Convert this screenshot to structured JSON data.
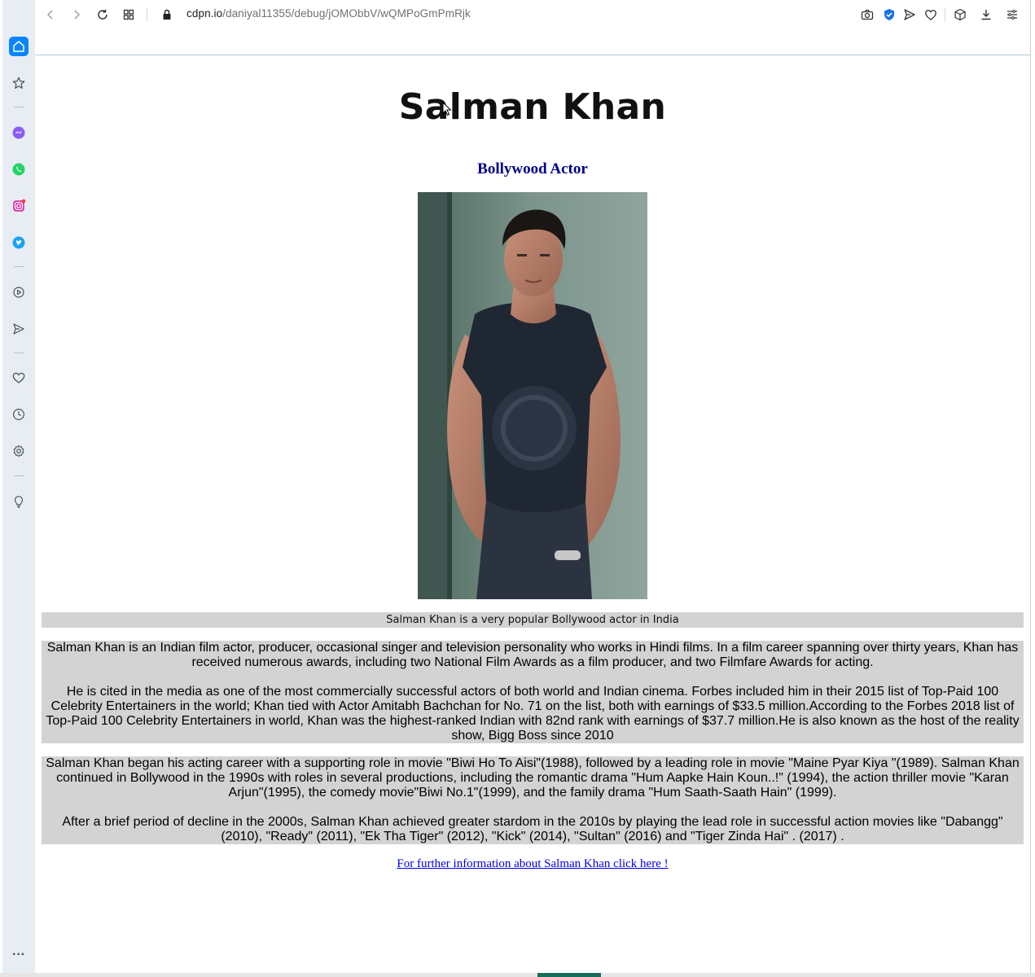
{
  "browser": {
    "url_domain": "cdpn.io",
    "url_path": "/daniyal11355/debug/jOMObbV/wQMPoGmPmRjk",
    "toolbar_icons": [
      "back-icon",
      "forward-icon",
      "reload-icon",
      "tabs-grid-icon",
      "lock-icon",
      "camera-icon",
      "shield-icon",
      "send-icon",
      "heart-icon",
      "box-icon",
      "download-icon",
      "menu-icon"
    ]
  },
  "sidebar": {
    "items": [
      "home-icon",
      "star-icon",
      "messenger-icon",
      "whatsapp-icon",
      "instagram-icon",
      "twitter-icon",
      "player-icon",
      "send-icon",
      "heart-icon",
      "history-icon",
      "settings-icon",
      "lightbulb-icon",
      "more-icon"
    ],
    "more_label": "···"
  },
  "page": {
    "title": "Salman Khan",
    "subtitle": "Bollywood Actor",
    "caption": "Salman Khan is a very popular Bollywood actor in India",
    "block1": {
      "p1": "Salman Khan is an Indian film actor, producer, occasional singer and television personality who works in Hindi films. In a film career spanning over thirty years, Khan has received numerous awards, including two National Film Awards as a film producer, and two Filmfare Awards for acting.",
      "p2": "He is cited in the media as one of the most commercially successful actors of both world and Indian cinema. Forbes included him in their 2015 list of Top-Paid 100 Celebrity Entertainers in the world; Khan tied with Actor Amitabh Bachchan for No. 71 on the list, both with earnings of $33.5 million.According to the Forbes 2018 list of Top-Paid 100 Celebrity Entertainers in world, Khan was the highest-ranked Indian with 82nd rank with earnings of $37.7 million.He is also known as the host of the reality show, Bigg Boss since 2010"
    },
    "block2": {
      "p1": "Salman Khan began his acting career with a supporting role in movie \"Biwi Ho To Aisi\"(1988), followed by a leading role in movie \"Maine Pyar Kiya \"(1989). Salman Khan continued in Bollywood in the 1990s with roles in several productions, including the romantic drama \"Hum Aapke Hain Koun..!\" (1994), the action thriller movie \"Karan Arjun\"(1995), the comedy movie\"Biwi No.1\"(1999), and the family drama \"Hum Saath-Saath Hain\" (1999).",
      "p2": "After a brief period of decline in the 2000s, Salman Khan achieved greater stardom in the 2010s by playing the lead role in successful action movies like \"Dabangg\"(2010), \"Ready\" (2011), \"Ek Tha Tiger\" (2012), \"Kick\" (2014), \"Sultan\" (2016) and \"Tiger Zinda Hai\" . (2017) ."
    },
    "link_text": "For further information about Salman Khan click here !"
  },
  "colors": {
    "subtitle": "#00008b",
    "block_bg": "#d3d3d3",
    "link": "#0000ee",
    "sidebar_accent": "#0a84ff"
  }
}
